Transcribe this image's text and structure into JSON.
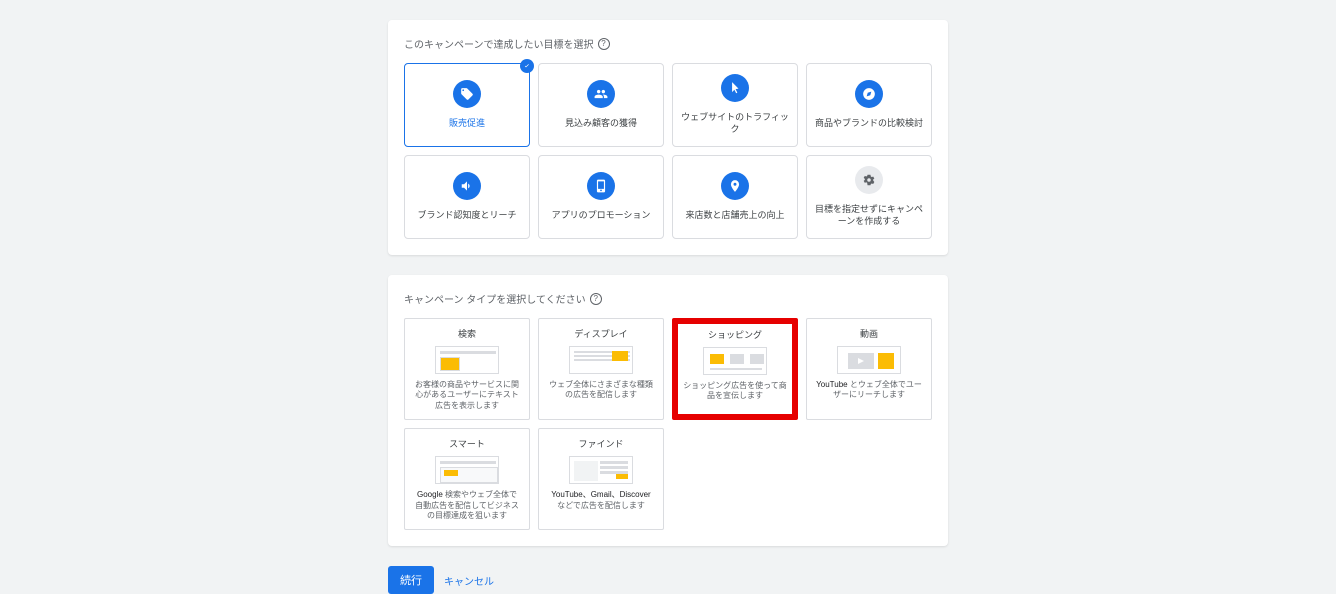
{
  "panel1": {
    "header": "このキャンペーンで達成したい目標を選択",
    "goals": [
      {
        "label": "販売促進",
        "id": "sales"
      },
      {
        "label": "見込み顧客の獲得",
        "id": "leads"
      },
      {
        "label": "ウェブサイトのトラフィック",
        "id": "traffic"
      },
      {
        "label": "商品やブランドの比較検討",
        "id": "consideration"
      },
      {
        "label": "ブランド認知度とリーチ",
        "id": "awareness"
      },
      {
        "label": "アプリのプロモーション",
        "id": "app"
      },
      {
        "label": "来店数と店舗売上の向上",
        "id": "store"
      },
      {
        "label": "目標を指定せずにキャンペーンを作成する",
        "id": "none"
      }
    ]
  },
  "panel2": {
    "header": "キャンペーン タイプを選択してください",
    "types": {
      "search": {
        "title": "検索",
        "desc": "お客様の商品やサービスに関心があるユーザーにテキスト広告を表示します"
      },
      "display": {
        "title": "ディスプレイ",
        "desc": "ウェブ全体にさまざまな種類の広告を配信します"
      },
      "shopping": {
        "title": "ショッピング",
        "desc": "ショッピング広告を使って商品を宣伝します"
      },
      "video": {
        "title": "動画",
        "desc_pre": "YouTube",
        "desc_post": " とウェブ全体でユーザーにリーチします"
      },
      "smart": {
        "title": "スマート",
        "desc_pre": "Google",
        "desc_post": " 検索やウェブ全体で自動広告を配信してビジネスの目標達成を狙います"
      },
      "find": {
        "title": "ファインド",
        "desc_pre": "YouTube、Gmail、Discover",
        "desc_post": " などで広告を配信します"
      }
    }
  },
  "buttons": {
    "continue": "続行",
    "cancel": "キャンセル"
  }
}
